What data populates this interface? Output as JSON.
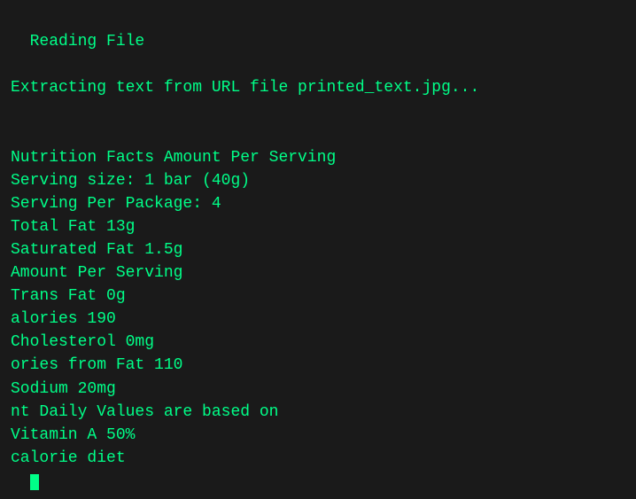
{
  "terminal": {
    "background": "#1a1a1a",
    "text_color": "#00ff88",
    "lines": [
      "Reading File",
      "",
      "Extracting text from URL file printed_text.jpg...",
      "",
      "",
      "Nutrition Facts Amount Per Serving",
      "Serving size: 1 bar (40g)",
      "Serving Per Package: 4",
      "Total Fat 13g",
      "Saturated Fat 1.5g",
      "Amount Per Serving",
      "Trans Fat 0g",
      "alories 190",
      "Cholesterol 0mg",
      "ories from Fat 110",
      "Sodium 20mg",
      "nt Daily Values are based on",
      "Vitamin A 50%",
      "calorie diet"
    ]
  }
}
